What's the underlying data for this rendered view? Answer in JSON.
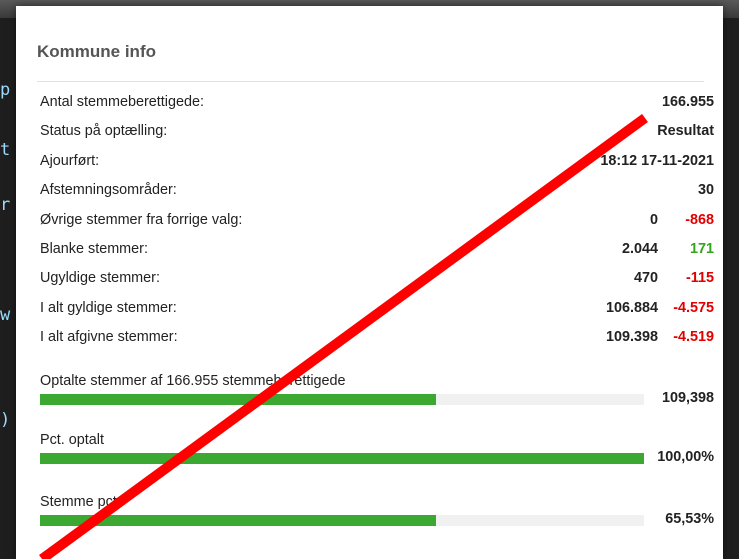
{
  "background": {
    "code_chars": [
      "p",
      "t",
      "r",
      "w",
      ")"
    ]
  },
  "panel": {
    "title": "Kommune info",
    "rows": [
      {
        "label": "Antal stemmeberettigede:",
        "value": "166.955",
        "change": null,
        "change_color": null
      },
      {
        "label": "Status på optælling:",
        "value": "Resultat",
        "change": null,
        "change_color": null
      },
      {
        "label": "Ajourført:",
        "value": "18:12 17-11-2021",
        "change": null,
        "change_color": null
      },
      {
        "label": "Afstemningsområder:",
        "value": "30",
        "change": null,
        "change_color": null
      },
      {
        "label": "Øvrige stemmer fra forrige valg:",
        "value": "0",
        "change": "-868",
        "change_color": "#e00000"
      },
      {
        "label": "Blanke stemmer:",
        "value": "2.044",
        "change": "171",
        "change_color": "#33a51c"
      },
      {
        "label": "Ugyldige stemmer:",
        "value": "470",
        "change": "-115",
        "change_color": "#e00000"
      },
      {
        "label": "I alt gyldige stemmer:",
        "value": "106.884",
        "change": "-4.575",
        "change_color": "#e00000"
      },
      {
        "label": "I alt afgivne stemmer:",
        "value": "109.398",
        "change": "-4.519",
        "change_color": "#e00000"
      }
    ],
    "bars": [
      {
        "label": "Optalte stemmer af 166.955 stemmeberettigede",
        "value": "109,398",
        "fill_fraction": 0.6553
      },
      {
        "label": "Pct. optalt",
        "value": "100,00%",
        "fill_fraction": 1.0
      },
      {
        "label": "Stemme pct.",
        "value": "65,53%",
        "fill_fraction": 0.6553
      }
    ]
  },
  "colors": {
    "accent_green": "#3aa831",
    "negative_red": "#e00000",
    "positive_green": "#33a51c",
    "overlay_line": "#ff0000"
  }
}
